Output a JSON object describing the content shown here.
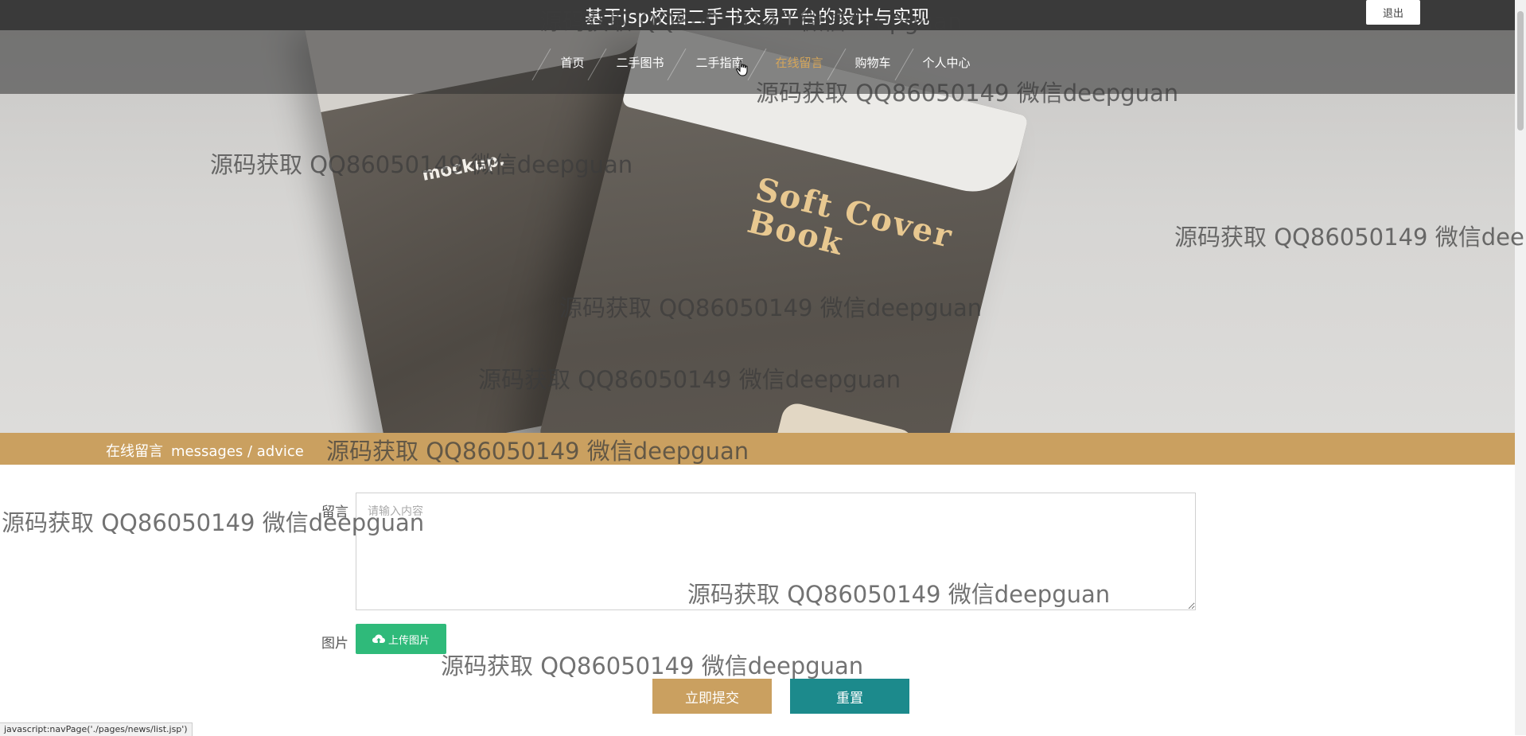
{
  "header": {
    "site_title": "基于jsp校园二手书交易平台的设计与实现",
    "logout_label": "退出"
  },
  "nav": {
    "items": [
      {
        "label": "首页"
      },
      {
        "label": "二手图书"
      },
      {
        "label": "二手指南"
      },
      {
        "label": "在线留言"
      },
      {
        "label": "购物车"
      },
      {
        "label": "个人中心"
      }
    ],
    "active": "在线留言"
  },
  "hero": {
    "book_cover_title_1": "Soft Cover",
    "book_cover_title_2": "Book",
    "book_small_text": "mockup."
  },
  "section": {
    "title": "在线留言",
    "subtitle": "messages / advice"
  },
  "form": {
    "message_label": "留言",
    "message_placeholder": "请输入内容",
    "image_label": "图片",
    "upload_label": "上传图片",
    "submit_label": "立即提交",
    "reset_label": "重置"
  },
  "status_url": "javascript:navPage('./pages/news/list.jsp')",
  "watermark_text": "源码获取 QQ86050149 微信deepguan",
  "colors": {
    "accent_gold": "#caa060",
    "active_nav": "#d4a55a",
    "upload_green": "#2fba7a",
    "reset_teal": "#1c8a8c",
    "topbar": "#3a3a3a"
  }
}
